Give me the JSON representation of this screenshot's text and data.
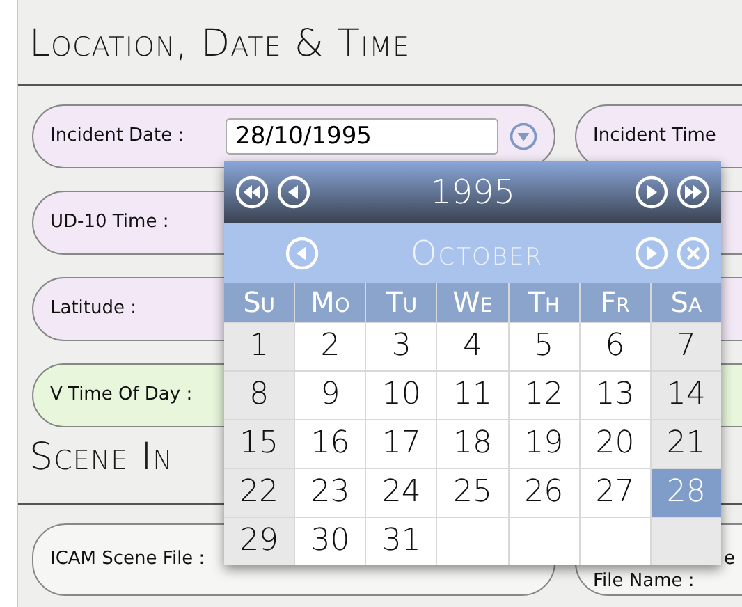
{
  "sections": [
    {
      "title": "Location, Date & Time",
      "rows": [
        {
          "color": "#f2e8f6",
          "left": {
            "label": "Incident Date :",
            "value": "28/10/1995"
          },
          "right": {
            "label": "Incident Time"
          }
        },
        {
          "color": "#f2e8f6",
          "left": {
            "label": "UD-10 Time :"
          },
          "right": {}
        },
        {
          "color": "#f2e8f6",
          "left": {
            "label": "Latitude :"
          },
          "right": {}
        },
        {
          "color": "#e8f7db",
          "left": {
            "label": "V Time Of Day :"
          },
          "right": {}
        }
      ]
    },
    {
      "title": "Scene In",
      "rows": [
        {
          "color": "#f6f6f5",
          "left": {
            "label": "ICAM Scene File :"
          },
          "right": {
            "label_lines": [
              "e",
              "File Name :"
            ]
          }
        }
      ]
    }
  ],
  "calendar": {
    "year": "1995",
    "month": "October",
    "weekdays": [
      "Su",
      "Mo",
      "Tu",
      "We",
      "Th",
      "Fr",
      "Sa"
    ],
    "weeks": [
      [
        {
          "day": "1",
          "selected": false
        },
        {
          "day": "2",
          "selected": false
        },
        {
          "day": "3",
          "selected": false
        },
        {
          "day": "4",
          "selected": false
        },
        {
          "day": "5",
          "selected": false
        },
        {
          "day": "6",
          "selected": false
        },
        {
          "day": "7",
          "selected": false
        }
      ],
      [
        {
          "day": "8",
          "selected": false
        },
        {
          "day": "9",
          "selected": false
        },
        {
          "day": "10",
          "selected": false
        },
        {
          "day": "11",
          "selected": false
        },
        {
          "day": "12",
          "selected": false
        },
        {
          "day": "13",
          "selected": false
        },
        {
          "day": "14",
          "selected": false
        }
      ],
      [
        {
          "day": "15",
          "selected": false
        },
        {
          "day": "16",
          "selected": false
        },
        {
          "day": "17",
          "selected": false
        },
        {
          "day": "18",
          "selected": false
        },
        {
          "day": "19",
          "selected": false
        },
        {
          "day": "20",
          "selected": false
        },
        {
          "day": "21",
          "selected": false
        }
      ],
      [
        {
          "day": "22",
          "selected": false
        },
        {
          "day": "23",
          "selected": false
        },
        {
          "day": "24",
          "selected": false
        },
        {
          "day": "25",
          "selected": false
        },
        {
          "day": "26",
          "selected": false
        },
        {
          "day": "27",
          "selected": false
        },
        {
          "day": "28",
          "selected": true
        }
      ],
      [
        {
          "day": "29",
          "selected": false
        },
        {
          "day": "30",
          "selected": false
        },
        {
          "day": "31",
          "selected": false
        }
      ]
    ]
  }
}
